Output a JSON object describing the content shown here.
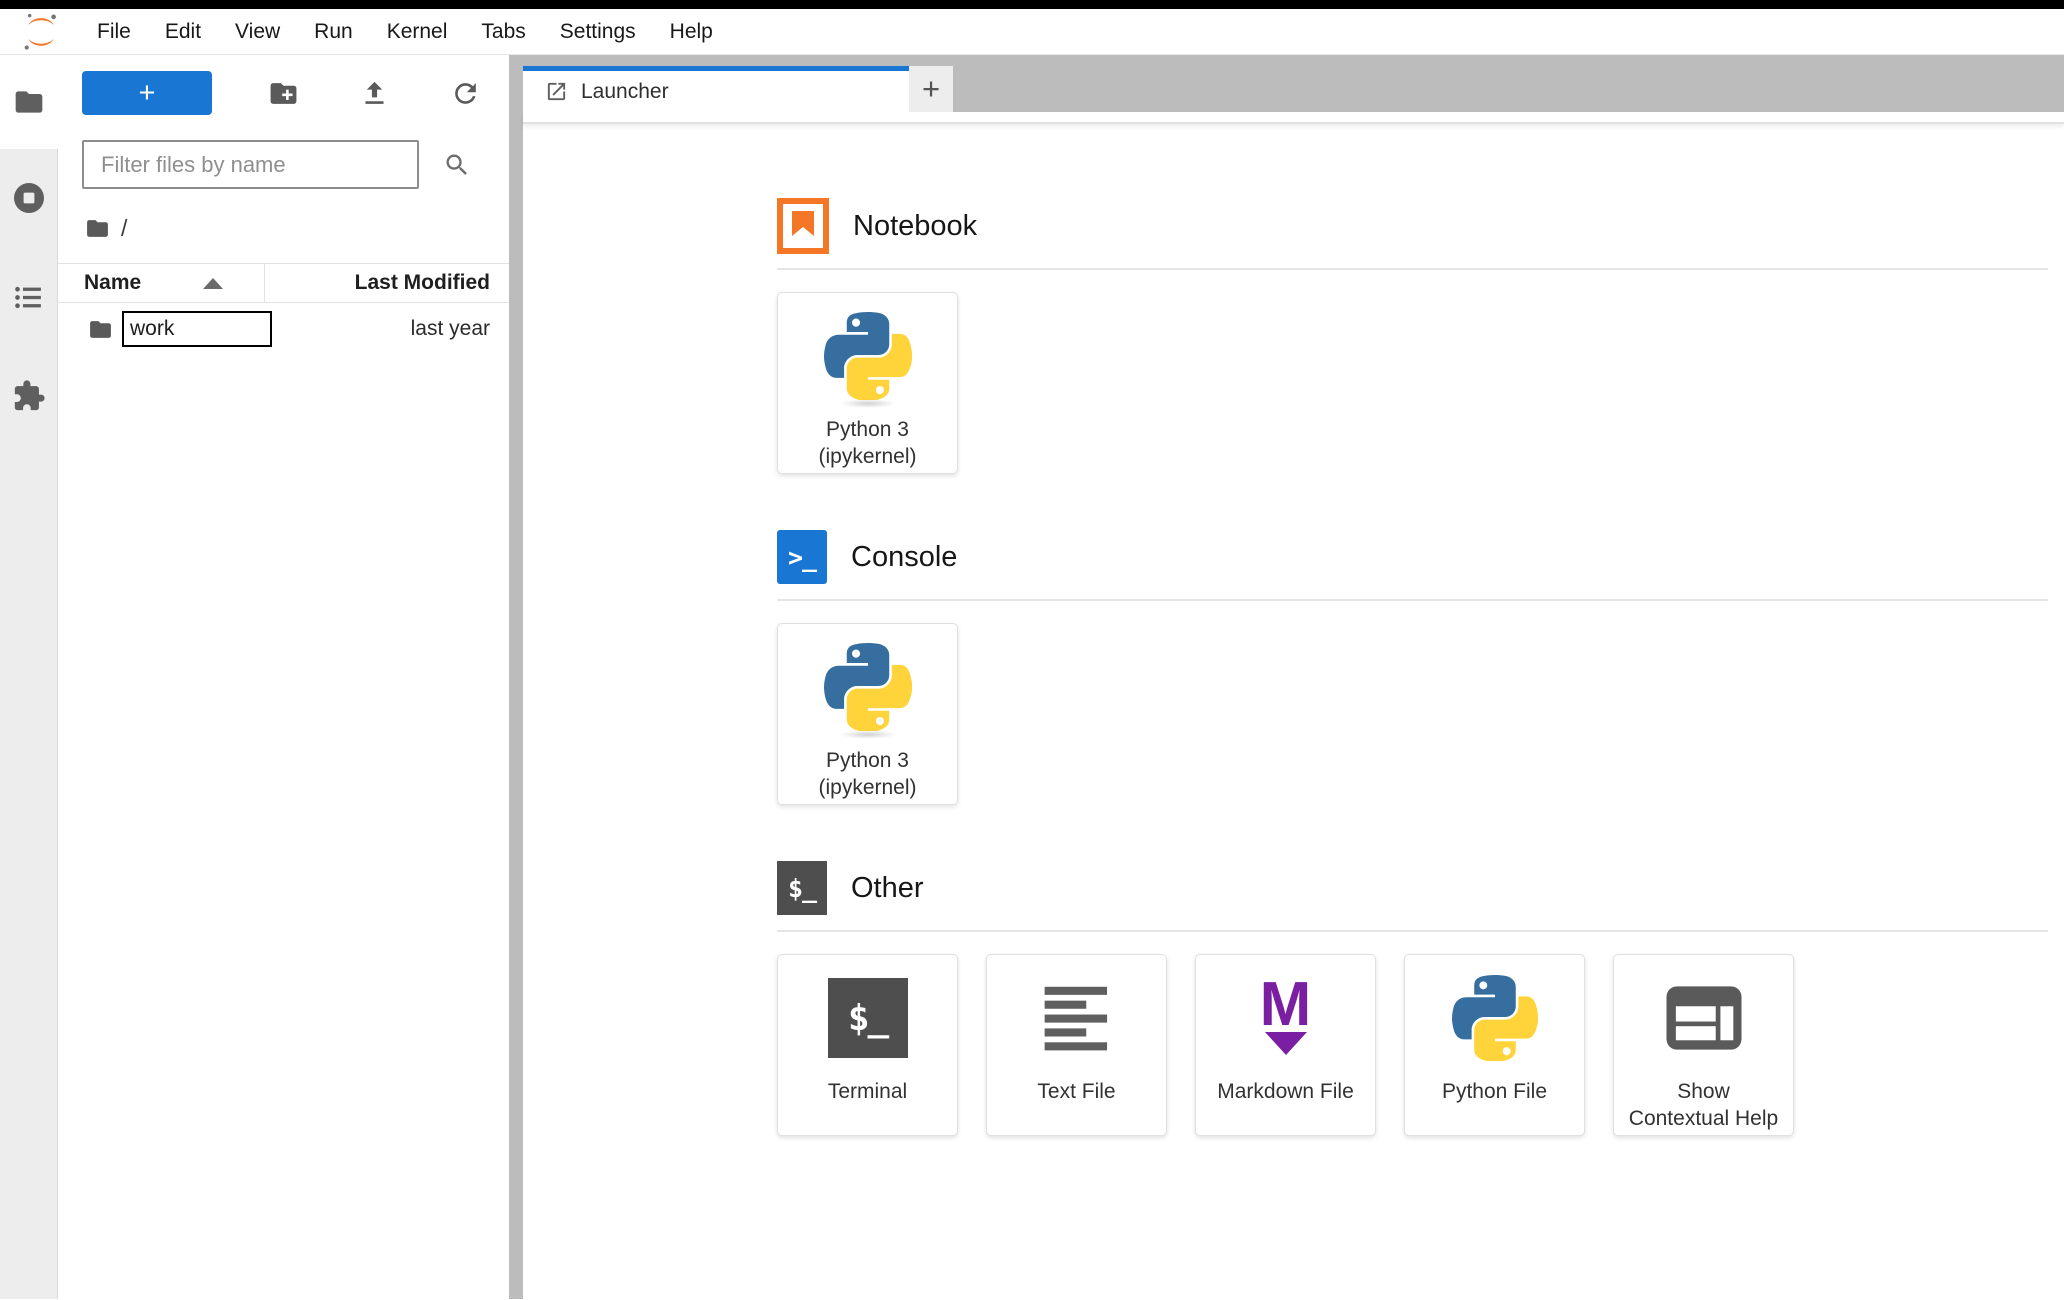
{
  "menu": {
    "items": [
      "File",
      "Edit",
      "View",
      "Run",
      "Kernel",
      "Tabs",
      "Settings",
      "Help"
    ]
  },
  "activity_bar": {
    "icons": [
      "folder-icon",
      "stop-circle-icon",
      "list-icon",
      "puzzle-icon"
    ],
    "active": "folder-icon"
  },
  "file_browser": {
    "toolbar": {
      "new_launcher_label": "+",
      "icons": [
        "new-folder-icon",
        "upload-icon",
        "refresh-icon"
      ]
    },
    "filter": {
      "placeholder": "Filter files by name"
    },
    "breadcrumb": {
      "root": "/"
    },
    "table": {
      "columns": [
        "Name",
        "Last Modified"
      ],
      "sort_column": "Name",
      "sort_direction": "ascending",
      "rows": [
        {
          "name": "work",
          "type": "folder",
          "last_modified": "last year",
          "renaming": true
        }
      ]
    }
  },
  "tab_bar": {
    "tabs": [
      {
        "label": "Launcher",
        "active": true
      }
    ],
    "new_tab_label": "+"
  },
  "launcher": {
    "sections": [
      {
        "title": "Notebook",
        "icon": "notebook-icon",
        "cards": [
          {
            "icon": "python-logo-icon",
            "label_lines": [
              "Python 3",
              "(ipykernel)"
            ]
          }
        ]
      },
      {
        "title": "Console",
        "icon": "console-icon",
        "icon_glyph": ">_",
        "cards": [
          {
            "icon": "python-logo-icon",
            "label_lines": [
              "Python 3",
              "(ipykernel)"
            ]
          }
        ]
      },
      {
        "title": "Other",
        "icon": "terminal-icon",
        "icon_glyph": "$_",
        "cards": [
          {
            "icon": "terminal-icon",
            "icon_glyph": "$_",
            "label_lines": [
              "Terminal"
            ]
          },
          {
            "icon": "text-file-icon",
            "label_lines": [
              "Text File"
            ]
          },
          {
            "icon": "markdown-icon",
            "icon_glyph": "M",
            "label_lines": [
              "Markdown File"
            ]
          },
          {
            "icon": "python-logo-icon",
            "label_lines": [
              "Python File"
            ]
          },
          {
            "icon": "contextual-help-icon",
            "label_lines": [
              "Show",
              "Contextual Help"
            ]
          }
        ]
      }
    ]
  },
  "colors": {
    "accent_blue": "#1976d2",
    "jupyter_orange": "#f37726",
    "markdown_purple": "#7b1fa2",
    "terminal_dark": "#4e4e4e",
    "icon_gray": "#5f5f5f",
    "tab_bar_gray": "#bcbcbc",
    "python_blue": "#306998",
    "python_yellow": "#ffd43b"
  }
}
